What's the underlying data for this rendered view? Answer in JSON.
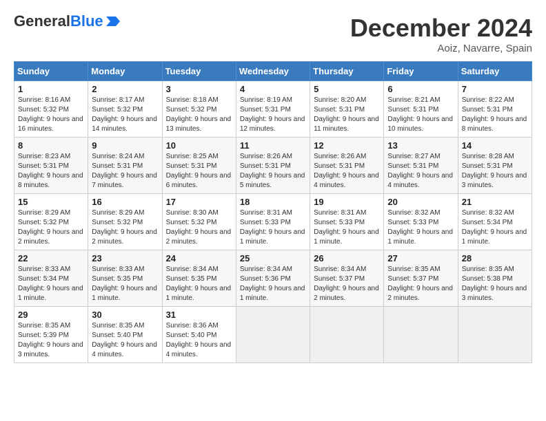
{
  "header": {
    "logo_general": "General",
    "logo_blue": "Blue",
    "month_title": "December 2024",
    "location": "Aoiz, Navarre, Spain"
  },
  "days_of_week": [
    "Sunday",
    "Monday",
    "Tuesday",
    "Wednesday",
    "Thursday",
    "Friday",
    "Saturday"
  ],
  "weeks": [
    [
      {
        "num": "1",
        "sunrise": "8:16 AM",
        "sunset": "5:32 PM",
        "daylight": "9 hours and 16 minutes."
      },
      {
        "num": "2",
        "sunrise": "8:17 AM",
        "sunset": "5:32 PM",
        "daylight": "9 hours and 14 minutes."
      },
      {
        "num": "3",
        "sunrise": "8:18 AM",
        "sunset": "5:32 PM",
        "daylight": "9 hours and 13 minutes."
      },
      {
        "num": "4",
        "sunrise": "8:19 AM",
        "sunset": "5:31 PM",
        "daylight": "9 hours and 12 minutes."
      },
      {
        "num": "5",
        "sunrise": "8:20 AM",
        "sunset": "5:31 PM",
        "daylight": "9 hours and 11 minutes."
      },
      {
        "num": "6",
        "sunrise": "8:21 AM",
        "sunset": "5:31 PM",
        "daylight": "9 hours and 10 minutes."
      },
      {
        "num": "7",
        "sunrise": "8:22 AM",
        "sunset": "5:31 PM",
        "daylight": "9 hours and 8 minutes."
      }
    ],
    [
      {
        "num": "8",
        "sunrise": "8:23 AM",
        "sunset": "5:31 PM",
        "daylight": "9 hours and 8 minutes."
      },
      {
        "num": "9",
        "sunrise": "8:24 AM",
        "sunset": "5:31 PM",
        "daylight": "9 hours and 7 minutes."
      },
      {
        "num": "10",
        "sunrise": "8:25 AM",
        "sunset": "5:31 PM",
        "daylight": "9 hours and 6 minutes."
      },
      {
        "num": "11",
        "sunrise": "8:26 AM",
        "sunset": "5:31 PM",
        "daylight": "9 hours and 5 minutes."
      },
      {
        "num": "12",
        "sunrise": "8:26 AM",
        "sunset": "5:31 PM",
        "daylight": "9 hours and 4 minutes."
      },
      {
        "num": "13",
        "sunrise": "8:27 AM",
        "sunset": "5:31 PM",
        "daylight": "9 hours and 4 minutes."
      },
      {
        "num": "14",
        "sunrise": "8:28 AM",
        "sunset": "5:31 PM",
        "daylight": "9 hours and 3 minutes."
      }
    ],
    [
      {
        "num": "15",
        "sunrise": "8:29 AM",
        "sunset": "5:32 PM",
        "daylight": "9 hours and 2 minutes."
      },
      {
        "num": "16",
        "sunrise": "8:29 AM",
        "sunset": "5:32 PM",
        "daylight": "9 hours and 2 minutes."
      },
      {
        "num": "17",
        "sunrise": "8:30 AM",
        "sunset": "5:32 PM",
        "daylight": "9 hours and 2 minutes."
      },
      {
        "num": "18",
        "sunrise": "8:31 AM",
        "sunset": "5:33 PM",
        "daylight": "9 hours and 1 minute."
      },
      {
        "num": "19",
        "sunrise": "8:31 AM",
        "sunset": "5:33 PM",
        "daylight": "9 hours and 1 minute."
      },
      {
        "num": "20",
        "sunrise": "8:32 AM",
        "sunset": "5:33 PM",
        "daylight": "9 hours and 1 minute."
      },
      {
        "num": "21",
        "sunrise": "8:32 AM",
        "sunset": "5:34 PM",
        "daylight": "9 hours and 1 minute."
      }
    ],
    [
      {
        "num": "22",
        "sunrise": "8:33 AM",
        "sunset": "5:34 PM",
        "daylight": "9 hours and 1 minute."
      },
      {
        "num": "23",
        "sunrise": "8:33 AM",
        "sunset": "5:35 PM",
        "daylight": "9 hours and 1 minute."
      },
      {
        "num": "24",
        "sunrise": "8:34 AM",
        "sunset": "5:35 PM",
        "daylight": "9 hours and 1 minute."
      },
      {
        "num": "25",
        "sunrise": "8:34 AM",
        "sunset": "5:36 PM",
        "daylight": "9 hours and 1 minute."
      },
      {
        "num": "26",
        "sunrise": "8:34 AM",
        "sunset": "5:37 PM",
        "daylight": "9 hours and 2 minutes."
      },
      {
        "num": "27",
        "sunrise": "8:35 AM",
        "sunset": "5:37 PM",
        "daylight": "9 hours and 2 minutes."
      },
      {
        "num": "28",
        "sunrise": "8:35 AM",
        "sunset": "5:38 PM",
        "daylight": "9 hours and 3 minutes."
      }
    ],
    [
      {
        "num": "29",
        "sunrise": "8:35 AM",
        "sunset": "5:39 PM",
        "daylight": "9 hours and 3 minutes."
      },
      {
        "num": "30",
        "sunrise": "8:35 AM",
        "sunset": "5:40 PM",
        "daylight": "9 hours and 4 minutes."
      },
      {
        "num": "31",
        "sunrise": "8:36 AM",
        "sunset": "5:40 PM",
        "daylight": "9 hours and 4 minutes."
      },
      null,
      null,
      null,
      null
    ]
  ]
}
